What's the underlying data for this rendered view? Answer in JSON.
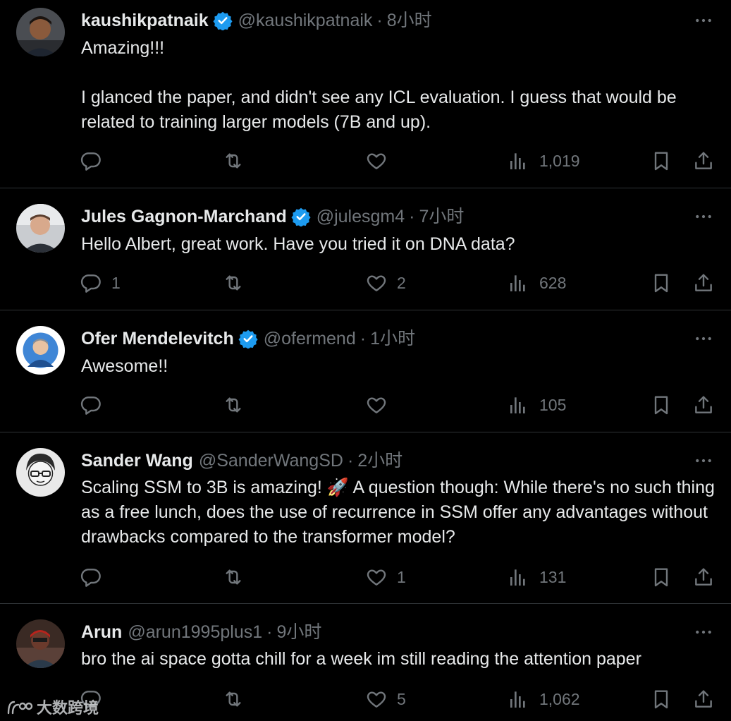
{
  "tweets": [
    {
      "name": "kaushikpatnaik",
      "verified": true,
      "handle": "@kaushikpatnaik",
      "dot": "·",
      "time": "8小时",
      "text": [
        "Amazing!!!",
        "I glanced the paper, and didn't see any ICL evaluation. I guess that would be related to training larger models (7B and up)."
      ],
      "replies": "",
      "retweets": "",
      "likes": "",
      "views": "1,019"
    },
    {
      "name": "Jules Gagnon-Marchand",
      "verified": true,
      "handle": "@julesgm4",
      "dot": "·",
      "time": "7小时",
      "text": [
        "Hello Albert, great work. Have you tried it on DNA data?"
      ],
      "replies": "1",
      "retweets": "",
      "likes": "2",
      "views": "628"
    },
    {
      "name": "Ofer Mendelevitch",
      "verified": true,
      "handle": "@ofermend",
      "dot": "·",
      "time": "1小时",
      "text": [
        "Awesome!!"
      ],
      "replies": "",
      "retweets": "",
      "likes": "",
      "views": "105"
    },
    {
      "name": "Sander Wang",
      "verified": false,
      "handle": "@SanderWangSD",
      "dot": "·",
      "time": "2小时",
      "text": [
        "Scaling SSM to 3B is amazing! 🚀 A question though: While there's no such thing as a free lunch, does the use of recurrence in SSM offer any advantages without drawbacks compared to the transformer model?"
      ],
      "replies": "",
      "retweets": "",
      "likes": "1",
      "views": "131"
    },
    {
      "name": "Arun",
      "verified": false,
      "handle": "@arun1995plus1",
      "dot": "·",
      "time": "9小时",
      "text": [
        "bro the ai space gotta chill for a week im still reading the attention paper"
      ],
      "replies": "",
      "retweets": "",
      "likes": "5",
      "views": "1,062"
    }
  ],
  "watermark": {
    "text": "大数跨境"
  },
  "icons": {
    "reply": "reply-icon",
    "retweet": "retweet-icon",
    "like": "heart-icon",
    "views": "views-icon",
    "bookmark": "bookmark-icon",
    "share": "share-icon",
    "more": "more-icon",
    "verified": "verified-badge-icon"
  },
  "colors": {
    "background": "#000000",
    "text": "#e7e9ea",
    "secondary": "#71767b",
    "divider": "#2f3336",
    "verified": "#1d9bf0"
  }
}
